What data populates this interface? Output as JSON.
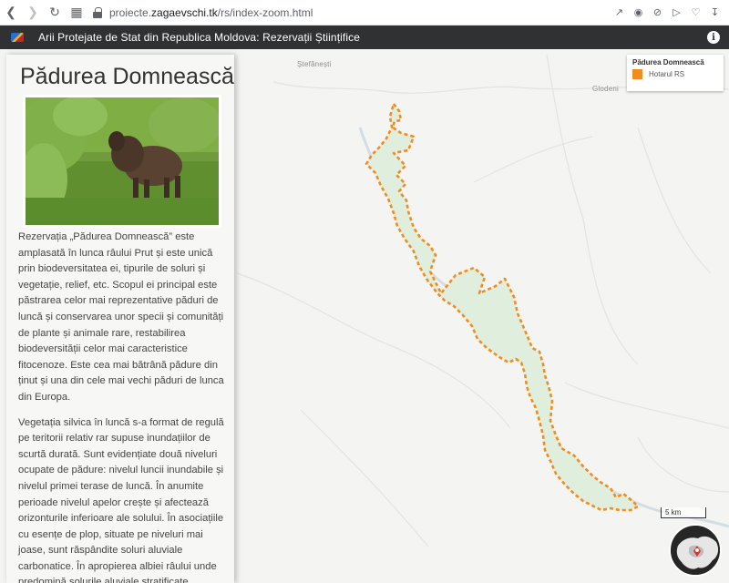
{
  "browser": {
    "url_prefix": "proiecte.",
    "url_host": "zagaevschi.tk",
    "url_path": "/rs/index-zoom.html",
    "icons": [
      "back-icon",
      "forward-icon",
      "reload-icon",
      "tabs-grid-icon",
      "lock-icon",
      "share-icon",
      "camera-icon",
      "adblock-icon",
      "send-icon",
      "heart-icon",
      "download-icon"
    ]
  },
  "header": {
    "title": "Arii Protejate de Stat din Republica Moldova: Rezervații Științifice",
    "info_symbol": "i"
  },
  "map": {
    "places": [
      "Ștefănești",
      "Glodeni"
    ],
    "reserve_fill": "#dfeedd",
    "reserve_stroke": "#f28c1e",
    "scale": "5 km"
  },
  "legend": {
    "title": "Pădurea Domnească",
    "item_label": "Hotarul RS",
    "item_color": "#f28c1e"
  },
  "panel": {
    "title": "Pădurea Domnească",
    "photo_subject": "bison-photo",
    "paragraphs": [
      "Rezervația „Pădurea Domnească” este amplasată în lunca râului Prut și este unică prin biodeversitatea ei, tipurile de soluri și vegetație, relief, etc. Scopul ei principal este păstrarea celor mai reprezentative păduri de luncă și conservarea unor specii și comunități de plante și animale rare, restabilirea biodeversității celor mai caracteristice fitocenoze. Este cea mai bătrână pădure din ținut și una din cele mai vechi păduri de lunca din Europa.",
      "Vegetația silvica în luncă s-a format de regulă pe teritorii relativ rar supuse inundațiilor de scurtă durată. Sunt evidențiate două niveluri ocupate de pădure: nivelul luncii inundabile și nivelul primei terase de luncă. În anumite perioade nivelul apelor crește și afectează orizonturile inferioare ale solului. În asociațiile cu esențe de plop, situate pe niveluri mai joase, sunt răspândite soluri aluviale carbonatice. În apropierea albiei râului unde predomină solurile aluviale stratificate"
    ]
  }
}
